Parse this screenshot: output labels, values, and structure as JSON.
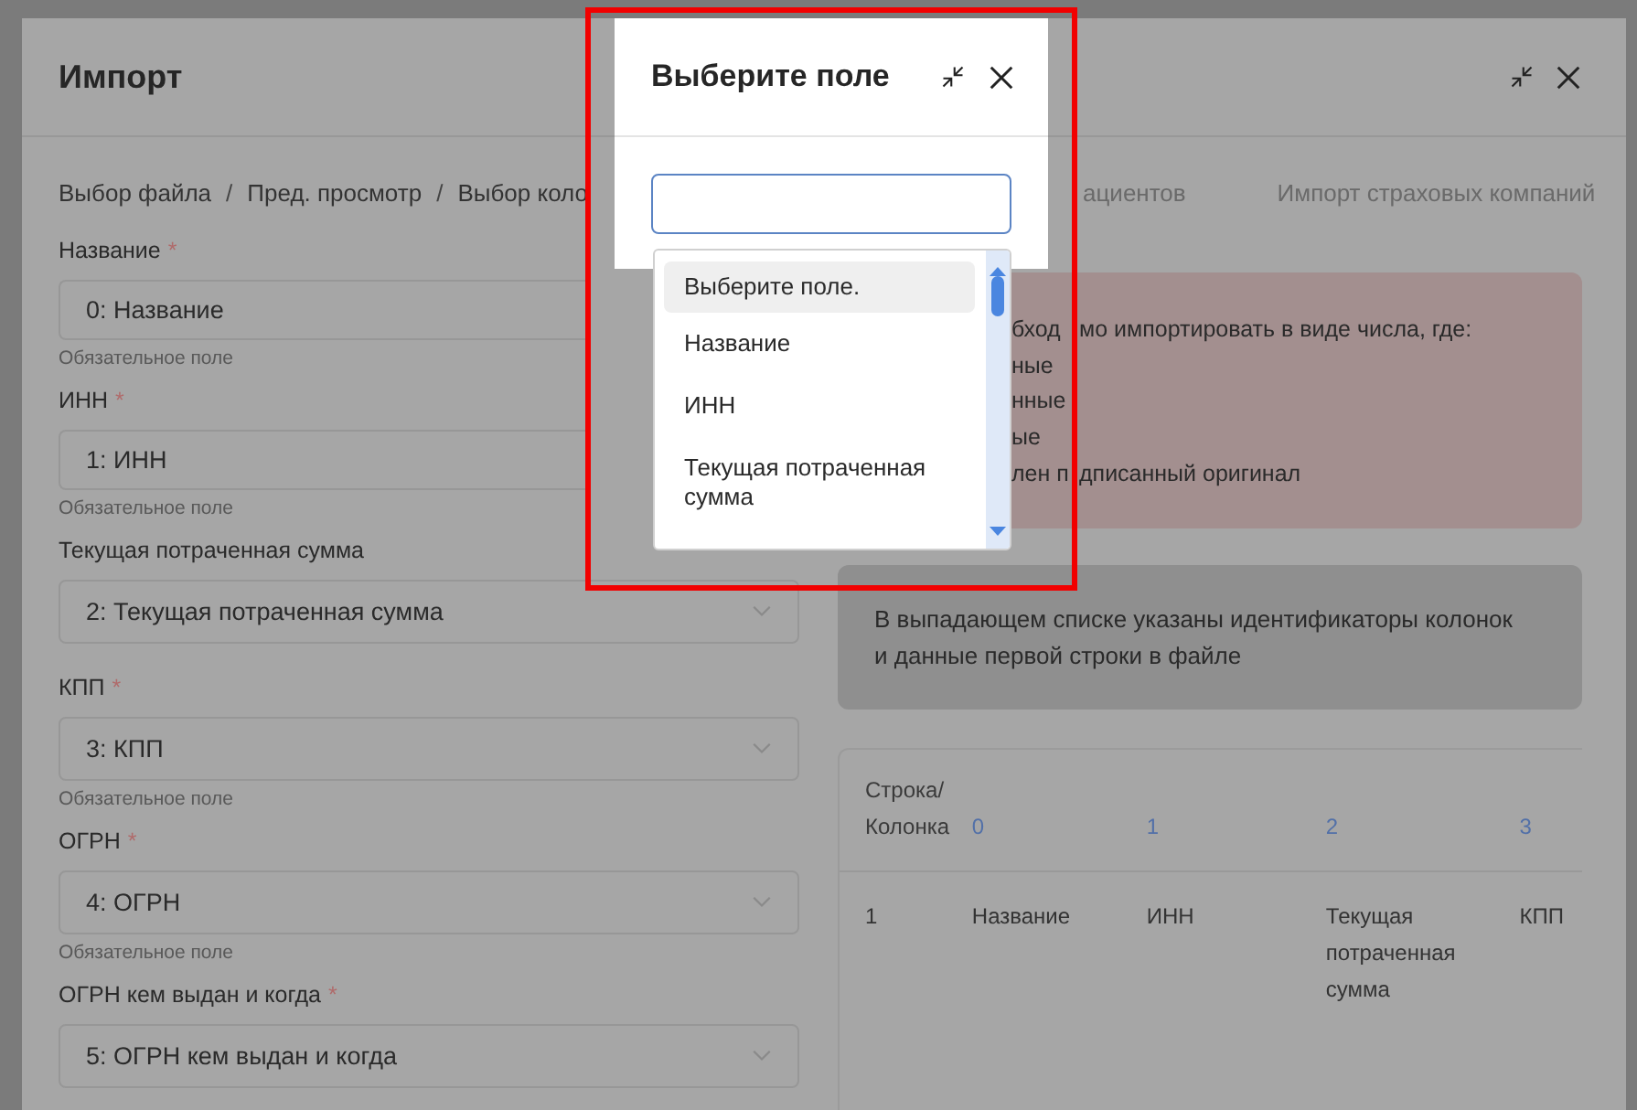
{
  "annotation": {
    "kind": "highlight"
  },
  "modal": {
    "title": "Импорт",
    "breadcrumb": [
      {
        "label": "Выбор файла",
        "separator": "/"
      },
      {
        "label": "Пред. просмотр",
        "separator": "/"
      },
      {
        "label": "Выбор коло"
      }
    ],
    "tabs": [
      {
        "label": "ациентов",
        "selected": false
      },
      {
        "label": "Импорт страховых компаний",
        "selected": false
      }
    ],
    "fields": [
      {
        "label": "Название",
        "required_mark": "*",
        "value": "0: Название",
        "hint": "Обязательное поле"
      },
      {
        "label": "ИНН",
        "required_mark": "*",
        "value": "1: ИНН",
        "hint": "Обязательное поле"
      },
      {
        "label": "Текущая потраченная сумма",
        "value": "2: Текущая потраченная сумма"
      },
      {
        "label": "КПП",
        "required_mark": "*",
        "value": "3: КПП",
        "hint": "Обязательное поле"
      },
      {
        "label": "ОГРН",
        "required_mark": "*",
        "value": "4: ОГРН",
        "hint": "Обязательное поле"
      },
      {
        "label": "ОГРН кем выдан и когда",
        "required_mark": "*",
        "value": "5: ОГРН кем выдан и когда"
      }
    ],
    "alert": {
      "kind": "error",
      "lines": [
        [
          "бход",
          "мо импортировать в виде числа, где:"
        ],
        [
          "ные"
        ],
        [
          "нные"
        ],
        [
          "ые"
        ],
        [
          "лен п",
          "дписанный оригинал"
        ]
      ]
    },
    "info": {
      "text": "В выпадающем списке указаны идентификаторы колонок и данные первой строки в файле"
    },
    "table": {
      "columns": [
        "Строка/ Колонка",
        "0",
        "1",
        "2",
        "3"
      ],
      "rows": [
        [
          "1",
          "Название",
          "ИНН",
          "Текущая потраченная сумма",
          "КПП"
        ]
      ]
    }
  },
  "popup": {
    "title": "Выберите поле",
    "options": [
      {
        "label": "Выберите поле.",
        "selected": true
      },
      {
        "label": "Название",
        "selected": false
      },
      {
        "label": "ИНН",
        "selected": false
      },
      {
        "label": "Текущая потраченная сумма",
        "selected": false
      }
    ]
  }
}
